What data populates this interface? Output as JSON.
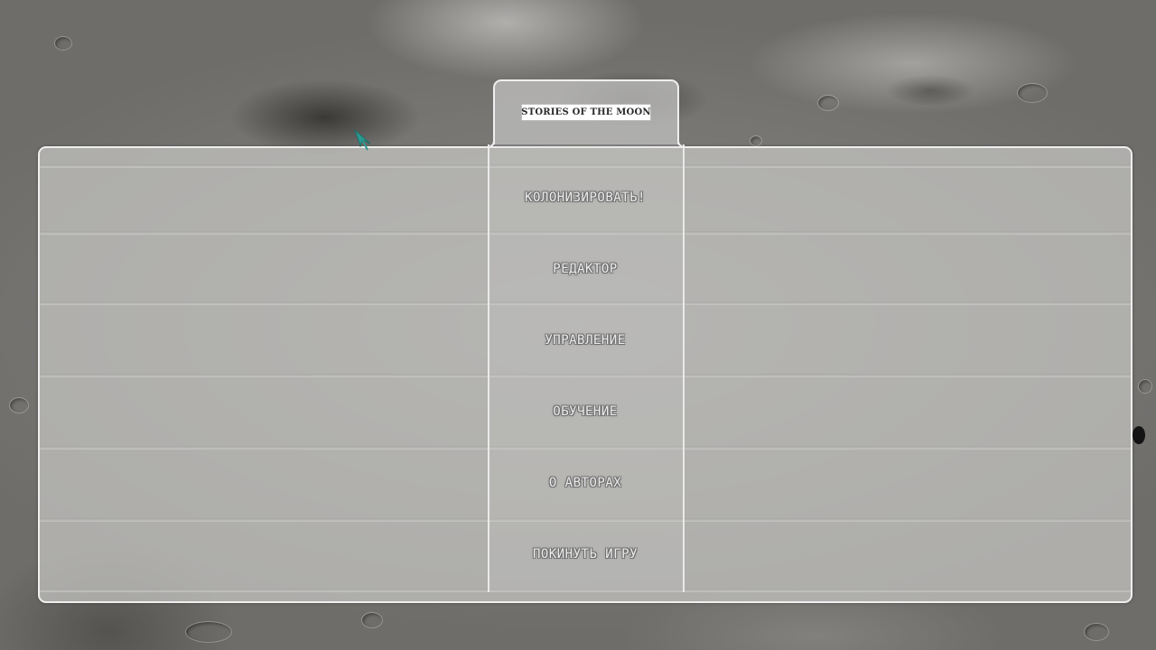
{
  "game": {
    "logo_text": "STORIES OF THE MOON"
  },
  "menu": {
    "items": [
      {
        "label": "КОЛОНИЗИРОВАТЬ!"
      },
      {
        "label": "РЕДАКТОР"
      },
      {
        "label": "УПРАВЛЕНИЕ"
      },
      {
        "label": "ОБУЧЕНИЕ"
      },
      {
        "label": "О АВТОРАХ"
      },
      {
        "label": "ПОКИНУТЬ ИГРУ"
      }
    ]
  },
  "colors": {
    "panel_border": "#efefef",
    "label_text": "#ececec",
    "label_outline": "#6e6e6e",
    "cursor_accent": "#2b9a91"
  },
  "icons": {
    "cursor": "cursor-icon",
    "dot": "dot-marker-icon"
  }
}
